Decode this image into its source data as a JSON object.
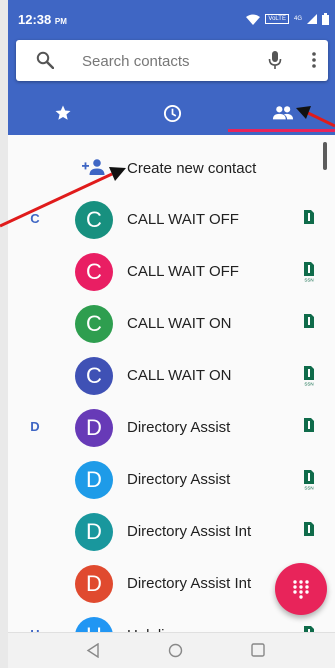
{
  "status_bar": {
    "time": "12:38",
    "ampm": "PM",
    "lte_label": "VoLTE",
    "network_label": "4G"
  },
  "search": {
    "placeholder": "Search contacts"
  },
  "tabs": [
    {
      "name": "favorites",
      "icon": "star-icon",
      "selected": false
    },
    {
      "name": "recents",
      "icon": "clock-icon",
      "selected": false
    },
    {
      "name": "contacts",
      "icon": "people-icon",
      "selected": true
    }
  ],
  "create_new_contact": {
    "label": "Create new contact"
  },
  "contacts": [
    {
      "section": "C",
      "initial": "C",
      "name": "CALL WAIT OFF",
      "avatar_color": "#17907f",
      "sim": "sim1"
    },
    {
      "section": "",
      "initial": "C",
      "name": "CALL WAIT OFF",
      "avatar_color": "#e91e63",
      "sim": "ssn"
    },
    {
      "section": "",
      "initial": "C",
      "name": "CALL WAIT ON",
      "avatar_color": "#2e9e4f",
      "sim": "sim1"
    },
    {
      "section": "",
      "initial": "C",
      "name": "CALL WAIT ON",
      "avatar_color": "#3f51b5",
      "sim": "ssn"
    },
    {
      "section": "D",
      "initial": "D",
      "name": "Directory Assist",
      "avatar_color": "#673ab7",
      "sim": "sim1"
    },
    {
      "section": "",
      "initial": "D",
      "name": "Directory Assist",
      "avatar_color": "#1e9be8",
      "sim": "ssn"
    },
    {
      "section": "",
      "initial": "D",
      "name": "Directory Assist Int",
      "avatar_color": "#19979d",
      "sim": "sim1"
    },
    {
      "section": "",
      "initial": "D",
      "name": "Directory Assist Int",
      "avatar_color": "#e04a2f",
      "sim": "ssn"
    },
    {
      "section": "H",
      "initial": "H",
      "name": "Helpline",
      "avatar_color": "#2196f3",
      "sim": "sim1"
    }
  ],
  "sim_labels": {
    "ssn": "SSN"
  },
  "colors": {
    "header": "#3f66c4",
    "accent": "#e8245a",
    "sim_icon": "#0f6b4a",
    "annotation_arrow": "#e01b1b"
  }
}
